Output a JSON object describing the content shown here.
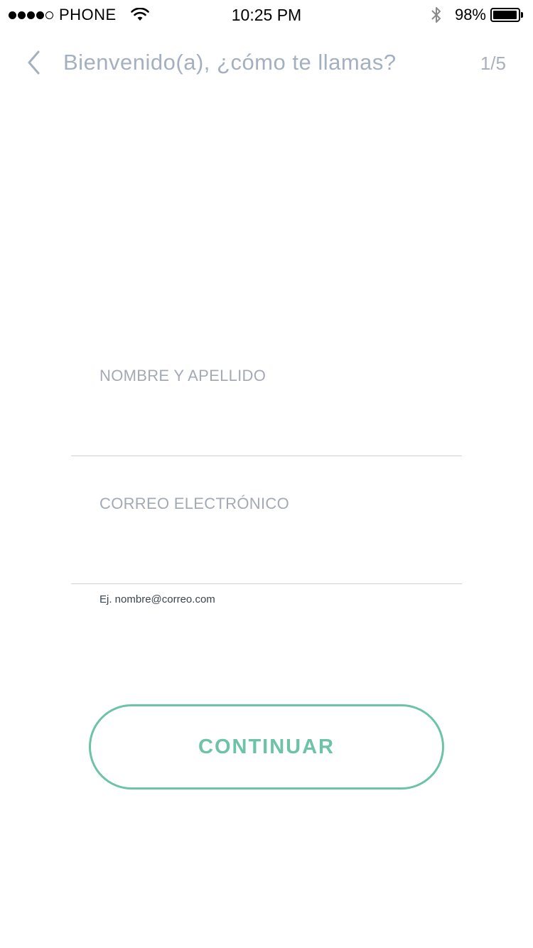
{
  "status_bar": {
    "carrier": "PHONE",
    "signal_bars_filled": 4,
    "signal_bars_total": 5,
    "time": "10:25 PM",
    "battery_percent": "98%",
    "battery_level": 0.98,
    "icons": [
      "wifi-icon",
      "bluetooth-icon",
      "battery-icon"
    ]
  },
  "header": {
    "back_icon": "chevron-left-icon",
    "title": "Bienvenido(a), ¿cómo te llamas?",
    "step": "1/5"
  },
  "form": {
    "name_field": {
      "label": "NOMBRE Y APELLIDO",
      "value": ""
    },
    "email_field": {
      "label": "CORREO ELECTRÓNICO",
      "value": "",
      "hint": "Ej. nombre@correo.com"
    }
  },
  "continue_button": {
    "label": "CONTINUAR"
  },
  "colors": {
    "accent": "#6cc3a7",
    "title": "#a4b0c0",
    "label": "#a3aab3",
    "divider": "#cfd3d7"
  }
}
